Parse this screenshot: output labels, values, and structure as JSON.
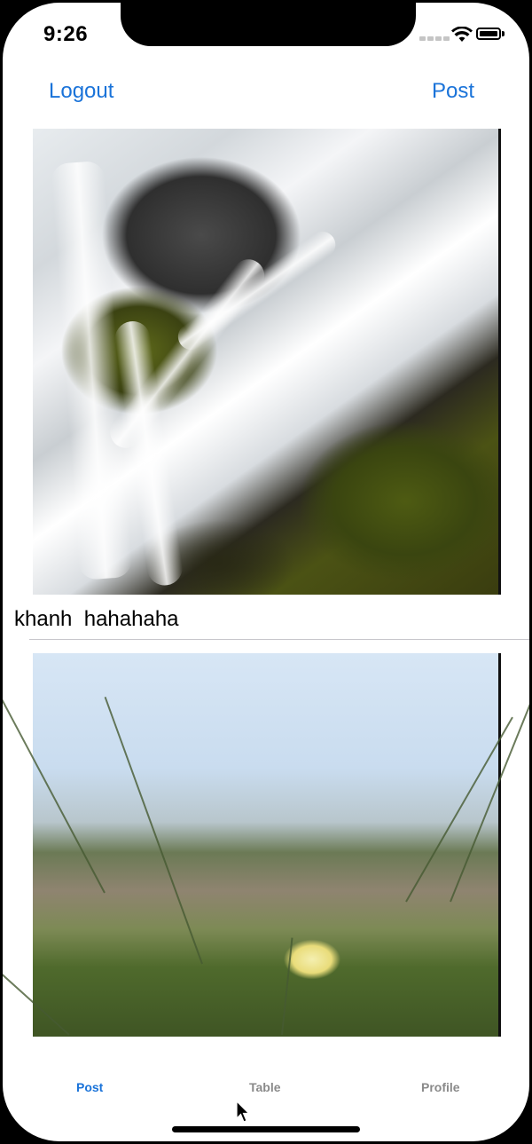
{
  "status_bar": {
    "time": "9:26"
  },
  "nav": {
    "left_label": "Logout",
    "right_label": "Post"
  },
  "feed": [
    {
      "image": "waterfall-photo",
      "caption": "khanh  hahahaha"
    },
    {
      "image": "beach-flower-photo",
      "caption": ""
    }
  ],
  "tabs": [
    {
      "label": "Post",
      "active": true
    },
    {
      "label": "Table",
      "active": false
    },
    {
      "label": "Profile",
      "active": false
    }
  ],
  "colors": {
    "accent": "#1a73d9",
    "inactive_tab": "#8a8a8a",
    "separator": "#c8c7cc"
  }
}
